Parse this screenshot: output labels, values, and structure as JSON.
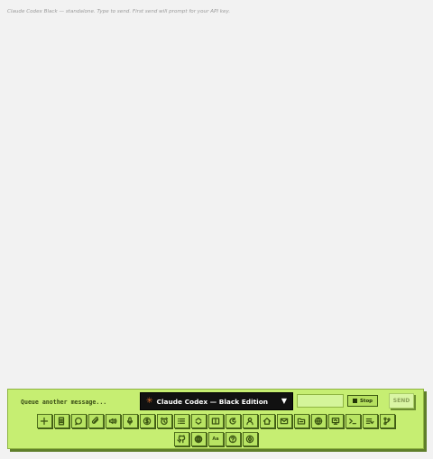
{
  "status_line": "Claude Codex Black — standalone. Type to send. First send will prompt for your API key.",
  "composer": {
    "placeholder": "Queue another message...",
    "model_label": "Claude Codex — Black Edition",
    "model_star": "✳",
    "model_caret": "▼",
    "status_field_value": "",
    "stop_label": "Stop",
    "send_label": "SEND"
  },
  "toolbar": {
    "row1": [
      "plus-icon",
      "document-icon",
      "chat-bubble-icon",
      "paperclip-icon",
      "speaker-icon",
      "microphone-icon",
      "dollar-icon",
      "alarm-clock-icon",
      "list-icon",
      "layers-icon",
      "book-icon",
      "refresh-icon",
      "user-icon",
      "home-icon",
      "mail-icon",
      "folder-icon",
      "globe-icon",
      "monitor-icon",
      "terminal-icon",
      "queue-list-icon",
      "git-branch-icon"
    ],
    "row2": [
      "github-icon",
      "language-icon",
      "font-size-icon",
      "help-icon",
      "settings-icon"
    ],
    "font_size_text": "Aa"
  },
  "colors": {
    "panel": "#c6ee72",
    "button": "#b8e463",
    "model_select_bg": "#111111",
    "star": "#e0722f"
  }
}
